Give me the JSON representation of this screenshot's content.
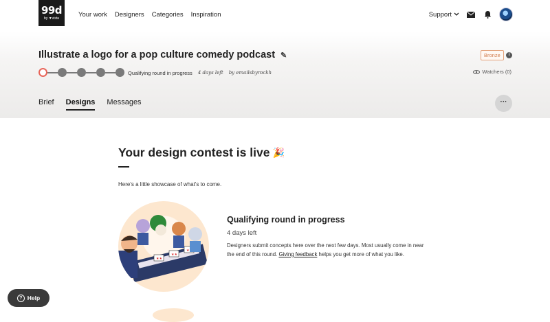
{
  "nav": {
    "logo_big": "99d",
    "logo_small": "by ▼vista",
    "links": [
      "Your work",
      "Designers",
      "Categories",
      "Inspiration"
    ],
    "support": "Support"
  },
  "contest": {
    "title": "Illustrate a logo for a pop culture comedy podcast",
    "tier": "Bronze",
    "status": "Qualifying round in progress",
    "time_left": "4 days left",
    "by": "by emailsbyrockh",
    "watchers": "Watchers (0)",
    "steps_total": 5,
    "current_step": 1
  },
  "tabs": [
    "Brief",
    "Designs",
    "Messages"
  ],
  "active_tab": "Designs",
  "more_label": "···",
  "main": {
    "heading": "Your design contest is live",
    "heading_emoji": "🎉",
    "intro": "Here's a little showcase of what's to come.",
    "card_title": "Qualifying round in progress",
    "card_sub": "4 days left",
    "card_body_1": "Designers submit concepts here over the next few days. Most usually come in near the end of this round. ",
    "card_link": "Giving feedback",
    "card_body_2": " helps you get more of what you like."
  },
  "help_label": "Help",
  "colors": {
    "accent_current": "#e8665a",
    "bronze": "#d07a4a",
    "dark": "#1a1a1a"
  }
}
